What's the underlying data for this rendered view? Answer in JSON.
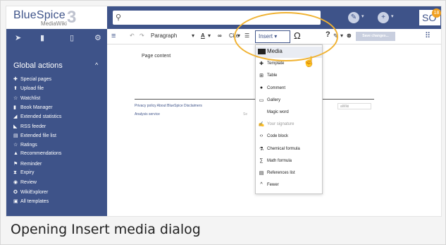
{
  "logo": {
    "main": "BlueSpice",
    "sub": "MediaWiki",
    "mark": "3"
  },
  "search": {
    "icon": "search-icon"
  },
  "topbar": {
    "edit_icon": "pencil-icon",
    "add_icon": "plus-icon",
    "avatar_initials": "SO",
    "notification_count": "18"
  },
  "sidebar": {
    "tools": [
      "navigation-icon",
      "page-icon",
      "clipboard-icon",
      "gear-icon"
    ],
    "section_title": "Global actions",
    "items": [
      {
        "label": "Special pages",
        "icon": "puzzle-icon",
        "glyph": "✚"
      },
      {
        "label": "Upload file",
        "icon": "upload-icon",
        "glyph": "⬆"
      },
      {
        "label": "Watchlist",
        "icon": "star-icon",
        "glyph": "☆"
      },
      {
        "label": "Book Manager",
        "icon": "book-icon",
        "glyph": "▮"
      },
      {
        "label": "Extended statistics",
        "icon": "chart-icon",
        "glyph": "◢"
      },
      {
        "label": "RSS feeder",
        "icon": "rss-icon",
        "glyph": "◣"
      },
      {
        "label": "Extended file list",
        "icon": "list-icon",
        "glyph": "▤"
      },
      {
        "label": "Ratings",
        "icon": "star-outline-icon",
        "glyph": "☆"
      },
      {
        "label": "Recommendations",
        "icon": "thumb-icon",
        "glyph": "▲"
      },
      {
        "label": "Reminder",
        "icon": "flag-icon",
        "glyph": "⚑"
      },
      {
        "label": "Expiry",
        "icon": "hourglass-icon",
        "glyph": "⧗"
      },
      {
        "label": "Review",
        "icon": "eye-icon",
        "glyph": "◉"
      },
      {
        "label": "WikiExplorer",
        "icon": "compass-icon",
        "glyph": "✪"
      },
      {
        "label": "All templates",
        "icon": "template-icon",
        "glyph": "▣"
      }
    ]
  },
  "editor_toolbar": {
    "paragraph": "Paragraph",
    "cite": "Cite",
    "insert": "Insert",
    "save": "Save changes..."
  },
  "page": {
    "content": "Page content",
    "footer_links": "Privacy policy   About BlueSpice   Disclaimers",
    "analysis": "Analysis service",
    "search_fragment": "Se",
    "badge_fragment": "aWiki"
  },
  "insert_menu": {
    "items": [
      {
        "label": "Media",
        "icon": "media-icon",
        "glyph": ""
      },
      {
        "label": "Template",
        "icon": "puzzle-icon",
        "glyph": "✚"
      },
      {
        "label": "Table",
        "icon": "table-icon",
        "glyph": "⊞"
      },
      {
        "label": "Comment",
        "icon": "comment-icon",
        "glyph": "●"
      },
      {
        "label": "Gallery",
        "icon": "gallery-icon",
        "glyph": "▭"
      },
      {
        "label": "Magic word",
        "icon": "magic-icon",
        "glyph": ""
      },
      {
        "label": "Your signature",
        "icon": "signature-icon",
        "glyph": "✍"
      },
      {
        "label": "Code block",
        "icon": "code-icon",
        "glyph": "‹›"
      },
      {
        "label": "Chemical formula",
        "icon": "flask-icon",
        "glyph": "⚗"
      },
      {
        "label": "Math formula",
        "icon": "sigma-icon",
        "glyph": "∑"
      },
      {
        "label": "References list",
        "icon": "references-icon",
        "glyph": "▤"
      },
      {
        "label": "Fewer",
        "icon": "chevron-up-icon",
        "glyph": "^"
      }
    ]
  },
  "caption": "Opening Insert media dialog",
  "colors": {
    "brand": "#3e5389",
    "highlight": "#f0b232"
  }
}
